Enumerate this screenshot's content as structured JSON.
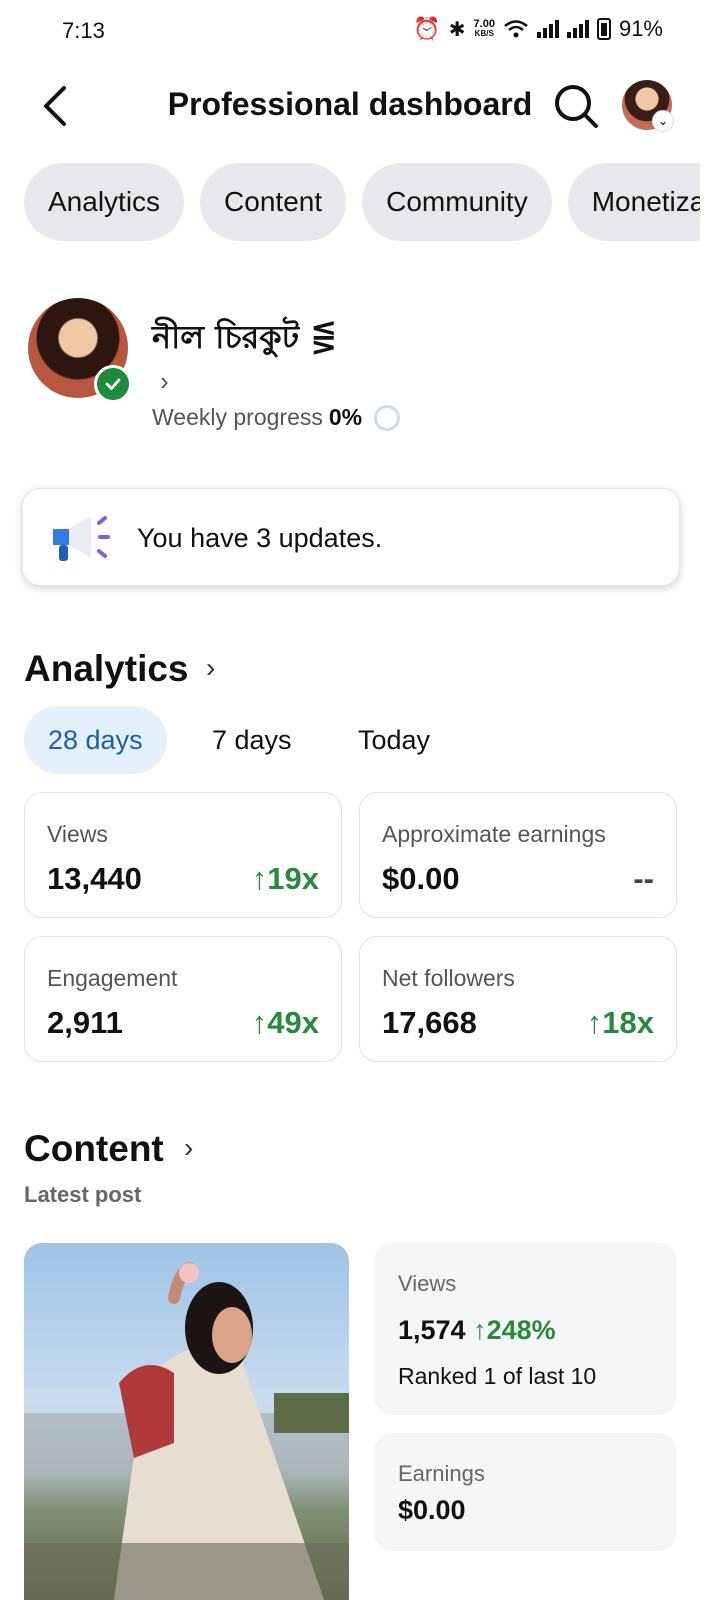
{
  "status_bar": {
    "time": "7:13",
    "speed_value": "7.00",
    "speed_unit": "KB/S",
    "battery": "91%"
  },
  "header": {
    "title": "Professional dashboard"
  },
  "tabs": [
    {
      "label": "Analytics"
    },
    {
      "label": "Content"
    },
    {
      "label": "Community"
    },
    {
      "label": "Monetization"
    }
  ],
  "profile": {
    "name": "নীল চিরকুট ⋚",
    "weekly_label": "Weekly progress",
    "weekly_value": "0%",
    "weekly_progress": 0
  },
  "updates": {
    "text": "You have 3 updates."
  },
  "analytics": {
    "title": "Analytics",
    "periods": [
      {
        "label": "28 days",
        "active": true
      },
      {
        "label": "7 days",
        "active": false
      },
      {
        "label": "Today",
        "active": false
      }
    ],
    "metrics": [
      {
        "label": "Views",
        "value": "13,440",
        "change": "↑19x"
      },
      {
        "label": "Approximate earnings",
        "value": "$0.00",
        "change": "--"
      },
      {
        "label": "Engagement",
        "value": "2,911",
        "change": "↑49x"
      },
      {
        "label": "Net followers",
        "value": "17,668",
        "change": "↑18x"
      }
    ]
  },
  "content": {
    "title": "Content",
    "subtitle": "Latest post",
    "views_label": "Views",
    "views_value": "1,574",
    "views_change": "↑248%",
    "rank_text": "Ranked 1 of last 10",
    "earnings_label": "Earnings",
    "earnings_value": "$0.00"
  },
  "colors": {
    "accent_blue": "#1a5fb4",
    "positive_green": "#2a8a3c",
    "chip_gray": "#e6e8eb"
  }
}
